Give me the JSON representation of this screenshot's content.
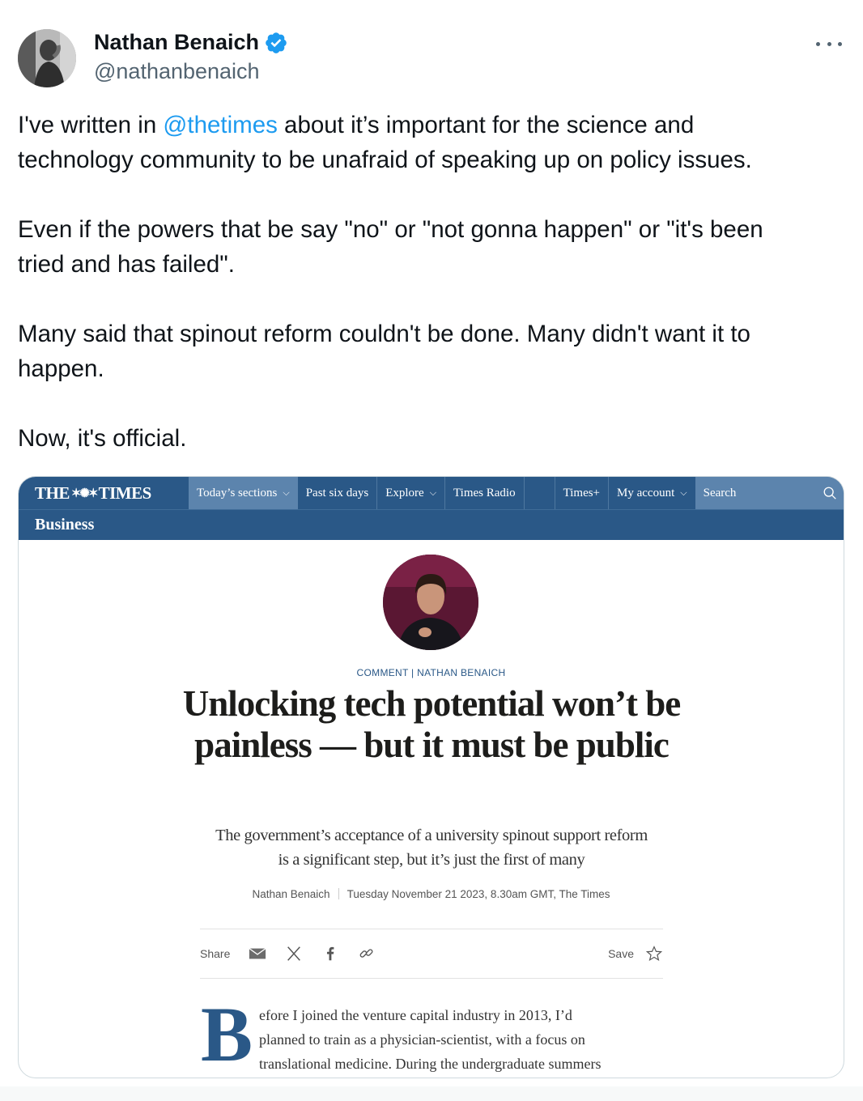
{
  "author": {
    "display_name": "Nathan Benaich",
    "handle": "@nathanbenaich",
    "verified": true,
    "verified_color": "#1d9bf0"
  },
  "tweet": {
    "line1_before": "I've written in ",
    "mention": "@thetimes",
    "line1_after": " about it’s important for the science and",
    "line2": "technology community to be unafraid of speaking up on policy issues.",
    "line3": "Even if the powers that be say \"no\" or \"not gonna happen\" or \"it's been",
    "line4": "tried and has failed\".",
    "line5": "Many said that spinout reform couldn't be done. Many didn't want it to",
    "line6": "happen.",
    "line7": "Now, it's official."
  },
  "card": {
    "nav": {
      "logo_left": "THE",
      "logo_right": "TIMES",
      "items": [
        "Today’s sections",
        "Past six days",
        "Explore",
        "Times Radio",
        "Times+",
        "My account"
      ],
      "search": "Search",
      "brand_color": "#2a5887"
    },
    "section": "Business",
    "kicker": "COMMENT | NATHAN BENAICH",
    "headline": "Unlocking tech potential won’t be painless — but it must be public",
    "standfirst": "The government’s acceptance of a university spinout support reform is a significant step, but it’s just the first of many",
    "byline_author": "Nathan Benaich",
    "byline_meta": "Tuesday November 21 2023, 8.30am GMT, The Times",
    "share_label": "Share",
    "save_label": "Save",
    "dropcap": "B",
    "body_lines": [
      "efore I joined the venture capital industry in 2013, I’d",
      "planned to train as a physician-scientist, with a focus on",
      "translational medicine. During the undergraduate summers"
    ]
  }
}
